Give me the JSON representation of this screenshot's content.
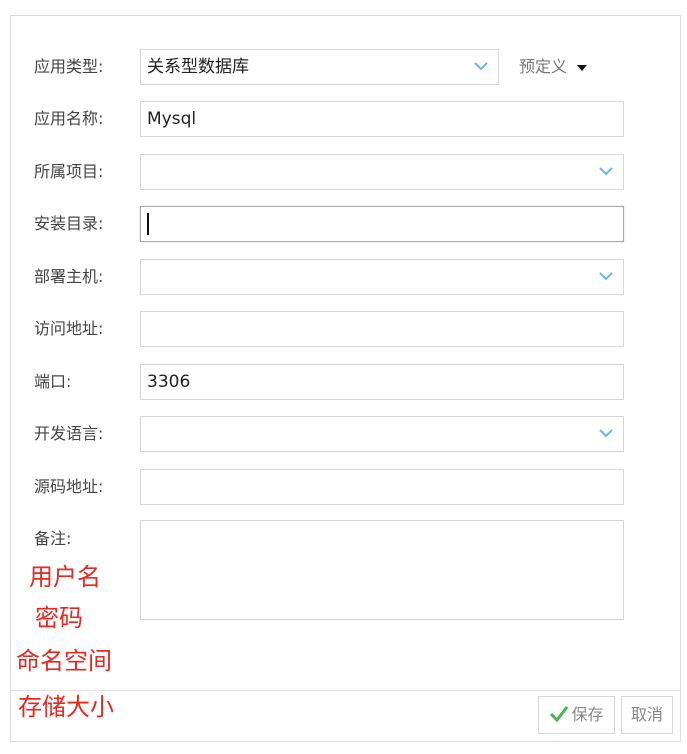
{
  "form": {
    "app_type": {
      "label": "应用类型:",
      "value": "关系型数据库",
      "predefined": "预定义"
    },
    "app_name": {
      "label": "应用名称:",
      "value": "Mysql"
    },
    "project": {
      "label": "所属项目:",
      "value": ""
    },
    "install_dir": {
      "label": "安装目录:",
      "value": ""
    },
    "host": {
      "label": "部署主机:",
      "value": ""
    },
    "access_url": {
      "label": "访问地址:",
      "value": ""
    },
    "port": {
      "label": "端口:",
      "value": "3306"
    },
    "language": {
      "label": "开发语言:",
      "value": ""
    },
    "source_url": {
      "label": "源码地址:",
      "value": ""
    },
    "remark": {
      "label": "备注:",
      "value": ""
    }
  },
  "buttons": {
    "save": "保存",
    "cancel": "取消"
  },
  "annotations": [
    "用户名",
    "密码",
    "命名空间",
    "存储大小"
  ],
  "colors": {
    "chevron": "#6cb6e6",
    "annotation": "#e8271f",
    "check": "#4caf50"
  }
}
